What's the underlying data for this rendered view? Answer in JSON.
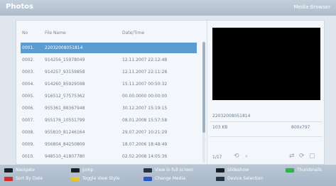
{
  "app": {
    "title": "Photos",
    "subtitle": "Media Browser"
  },
  "list": {
    "headers": {
      "no": "No",
      "file_name": "File Name",
      "datetime": "Date/Time"
    },
    "rows": [
      {
        "no": "0001.",
        "name": "22032008051814",
        "date": "",
        "selected": true
      },
      {
        "no": "0002.",
        "name": "914256_15978049",
        "date": "12.11.2007 22:12:48",
        "selected": false
      },
      {
        "no": "0003.",
        "name": "914257_93159858",
        "date": "12.11.2007 22:11:28",
        "selected": false
      },
      {
        "no": "0004.",
        "name": "914260_85929598",
        "date": "15.11.2007 00:50:32",
        "selected": false
      },
      {
        "no": "0005.",
        "name": "916512_57575362",
        "date": "00.00.0000 00:00:00",
        "selected": false
      },
      {
        "no": "0006.",
        "name": "955361_88367948",
        "date": "30.12.2007 15:19:15",
        "selected": false
      },
      {
        "no": "0007.",
        "name": "955176_10551799",
        "date": "08.01.2008 15:57:58",
        "selected": false
      },
      {
        "no": "0008.",
        "name": "955810_81246164",
        "date": "29.07.2007 10:21:29",
        "selected": false
      },
      {
        "no": "0009.",
        "name": "956804_84250809",
        "date": "18.07.2006 18:48:49",
        "selected": false
      },
      {
        "no": "0010.",
        "name": "948510_41807780",
        "date": "02.02.2008 14:05:36",
        "selected": false
      }
    ]
  },
  "details": {
    "file_name": "22032008051814",
    "size": "103 KB",
    "resolution": "800x797",
    "position": "1/17"
  },
  "footer": {
    "navigate": "Navigate",
    "jump": "Jump",
    "view_full": "View in full screen",
    "slideshow": "Slideshow",
    "thumbnails": "Thumbnails",
    "sort_by_date": "Sort By Date",
    "toggle_view_style": "Toggle View Style",
    "change_media": "Change Media",
    "device_selection": "Device Selection"
  },
  "colors": {
    "selection": "#5a9bd0",
    "red": "#d12b2b",
    "yellow": "#e5c531",
    "blue": "#2b58c7",
    "green": "#2fb04b"
  }
}
